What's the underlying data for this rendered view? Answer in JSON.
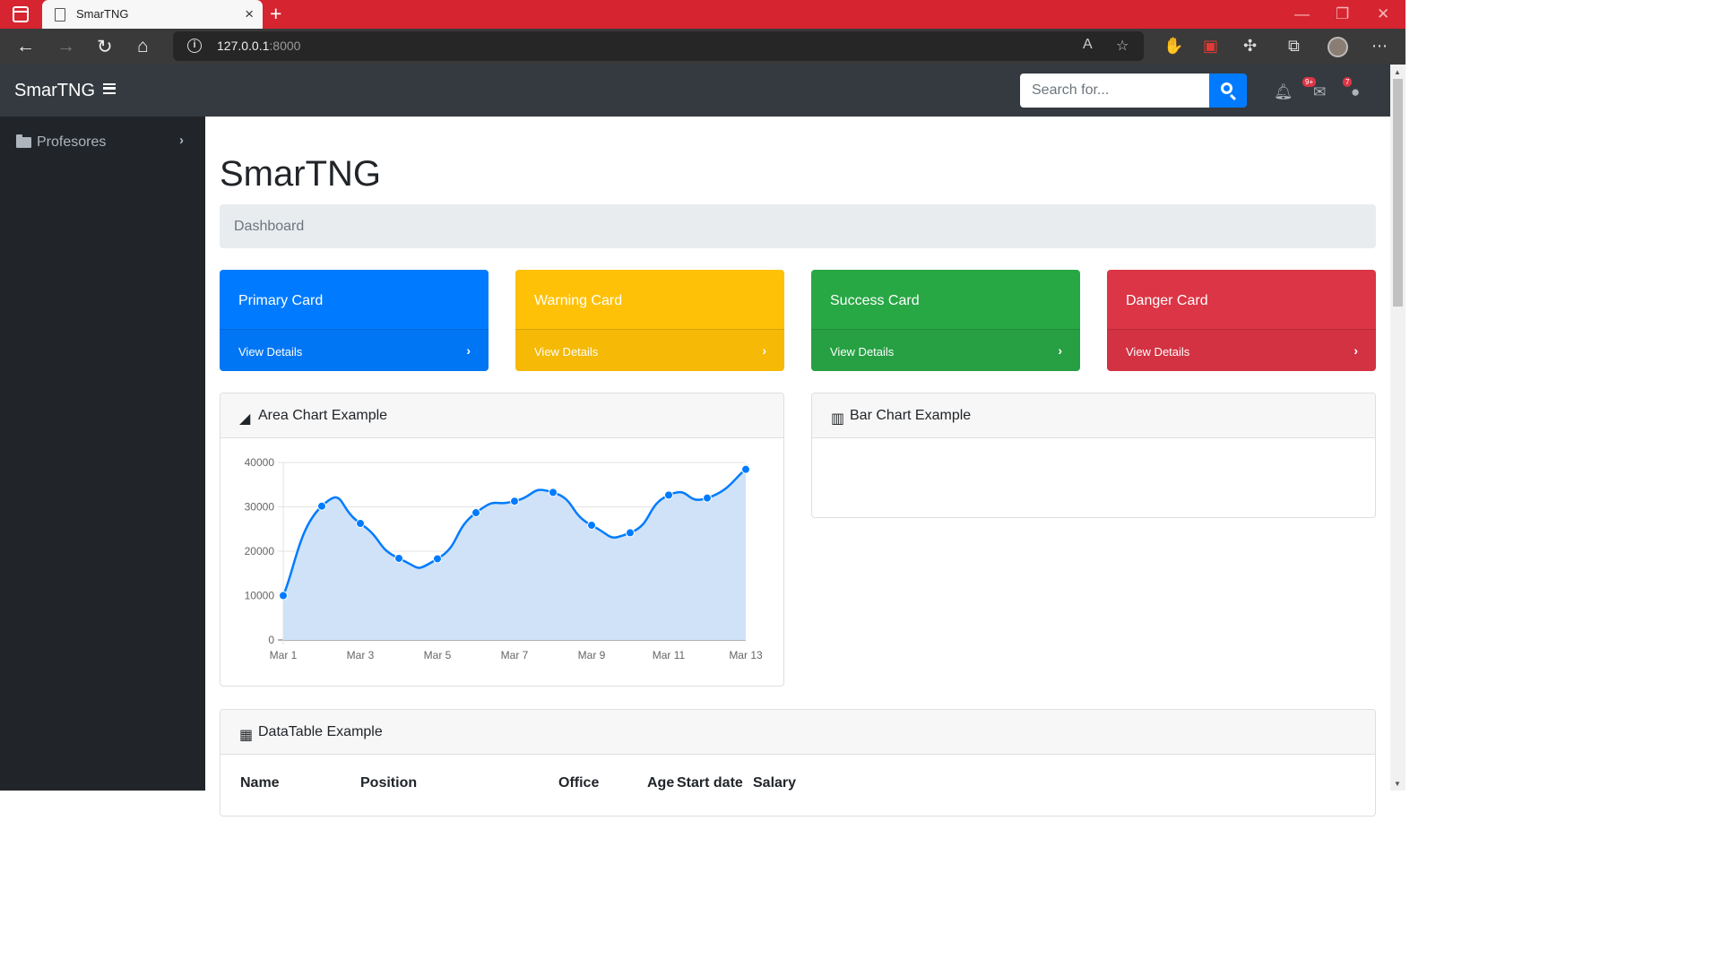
{
  "browser": {
    "tab_title": "SmarTNG",
    "url_host": "127.0.0.1",
    "url_port": ":8000",
    "new_tab": "+",
    "close_tab": "×"
  },
  "navbar": {
    "brand": "SmarTNG",
    "search_placeholder": "Search for...",
    "alerts_badge": "9+",
    "messages_badge": "7"
  },
  "sidebar": {
    "items": [
      {
        "label": "Profesores",
        "icon": "folder-icon"
      }
    ]
  },
  "main": {
    "title": "SmarTNG",
    "breadcrumb": "Dashboard",
    "cards": [
      {
        "title": "Primary Card",
        "link": "View Details",
        "color": "#007bff"
      },
      {
        "title": "Warning Card",
        "link": "View Details",
        "color": "#ffc107"
      },
      {
        "title": "Success Card",
        "link": "View Details",
        "color": "#28a745"
      },
      {
        "title": "Danger Card",
        "link": "View Details",
        "color": "#dc3545"
      }
    ],
    "area_panel_title": "Area Chart Example",
    "bar_panel_title": "Bar Chart Example",
    "table_panel_title": "DataTable Example",
    "table_columns": [
      "Name",
      "Position",
      "Office",
      "Age",
      "Start date",
      "Salary"
    ]
  },
  "chart_data": {
    "type": "area",
    "title": "Area Chart Example",
    "categories": [
      "Mar 1",
      "Mar 2",
      "Mar 3",
      "Mar 4",
      "Mar 5",
      "Mar 6",
      "Mar 7",
      "Mar 8",
      "Mar 9",
      "Mar 10",
      "Mar 11",
      "Mar 12",
      "Mar 13"
    ],
    "x_tick_labels": [
      "Mar 1",
      "Mar 3",
      "Mar 5",
      "Mar 7",
      "Mar 9",
      "Mar 11",
      "Mar 13"
    ],
    "values": [
      10000,
      30162,
      26263,
      18394,
      18287,
      28682,
      31274,
      33259,
      25849,
      24159,
      32651,
      31984,
      38451
    ],
    "ylim": [
      0,
      40000
    ],
    "y_ticks": [
      0,
      10000,
      20000,
      30000,
      40000
    ],
    "grid": true,
    "line_color": "#007bff",
    "fill_color": "#cfe2f7"
  }
}
